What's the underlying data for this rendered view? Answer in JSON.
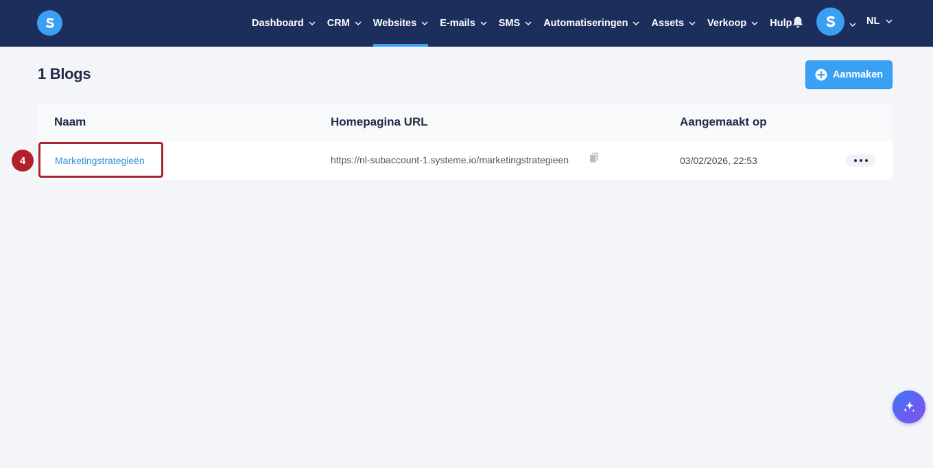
{
  "nav": {
    "items": [
      {
        "label": "Dashboard",
        "has_dropdown": true,
        "active": false
      },
      {
        "label": "CRM",
        "has_dropdown": true,
        "active": false
      },
      {
        "label": "Websites",
        "has_dropdown": true,
        "active": true
      },
      {
        "label": "E-mails",
        "has_dropdown": true,
        "active": false
      },
      {
        "label": "SMS",
        "has_dropdown": true,
        "active": false
      },
      {
        "label": "Automatiseringen",
        "has_dropdown": true,
        "active": false
      },
      {
        "label": "Assets",
        "has_dropdown": true,
        "active": false
      },
      {
        "label": "Verkoop",
        "has_dropdown": true,
        "active": false
      },
      {
        "label": "Hulp",
        "has_dropdown": false,
        "active": false
      }
    ],
    "language": "NL",
    "colors": {
      "bar": "#1c2e5c",
      "accent": "#3aa0f3"
    }
  },
  "page": {
    "title": "1 Blogs",
    "create_label": "Aanmaken"
  },
  "table": {
    "headers": [
      "Naam",
      "Homepagina URL",
      "Aangemaakt op"
    ],
    "rows": [
      {
        "name": "Marketingstrategieën",
        "url": "https://nl-subaccount-1.systeme.io/marketingstrategieen",
        "created": "03/02/2026, 22:53"
      }
    ]
  },
  "annotation": {
    "step_number": "4",
    "color": "#a8232e"
  }
}
